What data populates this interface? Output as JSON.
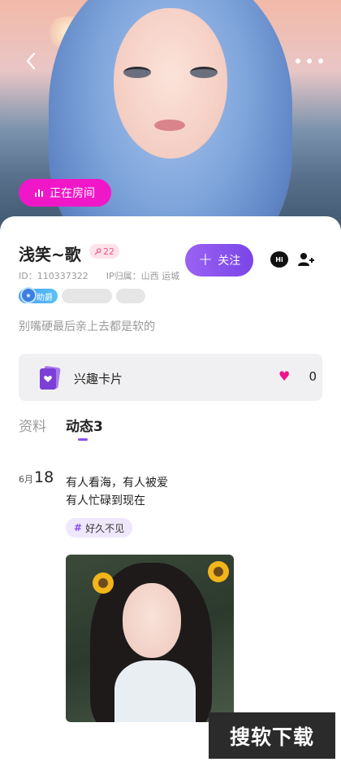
{
  "header": {
    "back_icon": "chevron-left-icon",
    "more_icon": "more-horizontal-icon"
  },
  "room_button": {
    "label": "正在房间",
    "icon": "audio-bars-icon"
  },
  "profile": {
    "name": "浅笑~歌",
    "level": "22",
    "id_text": "ID：110337322",
    "ip_text": "IP归属：山西 运城",
    "badge_label": "助爵",
    "bio": "别嘴硬最后亲上去都是软的"
  },
  "actions": {
    "follow_label": "关注",
    "hi_icon_text": "Hi",
    "add_friend_icon": "add-user-icon"
  },
  "interest_card": {
    "label": "兴趣卡片",
    "like_count": "0"
  },
  "tabs": [
    {
      "label": "资料"
    },
    {
      "label": "动态3"
    }
  ],
  "post": {
    "month": "6月",
    "day": "18",
    "text": "有人看海，有人被爱\n有人忙碌到现在",
    "hashtag": "好久不见"
  },
  "watermark": "搜软下载",
  "colors": {
    "accent_purple": "#8a4ff0",
    "room_pink": "#f017c9",
    "heart_pink": "#f0138a"
  }
}
